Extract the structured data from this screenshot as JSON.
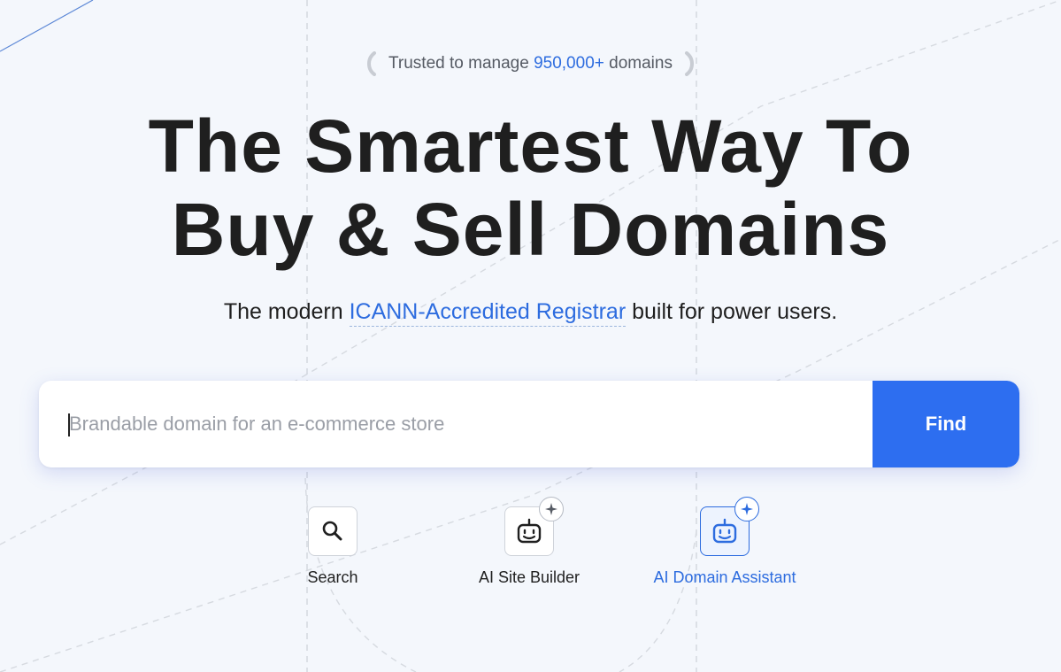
{
  "trust": {
    "prefix": "Trusted to manage",
    "count": "950,000+",
    "suffix": "domains"
  },
  "hero": {
    "title_line1": "The Smartest Way To",
    "title_line2": "Buy & Sell Domains"
  },
  "subtitle": {
    "prefix": "The modern",
    "link": "ICANN-Accredited Registrar",
    "suffix": "built for power users."
  },
  "search": {
    "placeholder": "Brandable domain for an e-commerce store",
    "value": "",
    "button_label": "Find"
  },
  "modes": [
    {
      "label": "Search",
      "icon": "search-icon",
      "active": false
    },
    {
      "label": "AI Site Builder",
      "icon": "robot-icon",
      "active": false
    },
    {
      "label": "AI Domain Assistant",
      "icon": "robot-icon",
      "active": true
    }
  ],
  "colors": {
    "accent": "#2d6cdf",
    "button": "#2d6ef0",
    "background": "#f4f7fc",
    "text": "#1f1f1f"
  }
}
